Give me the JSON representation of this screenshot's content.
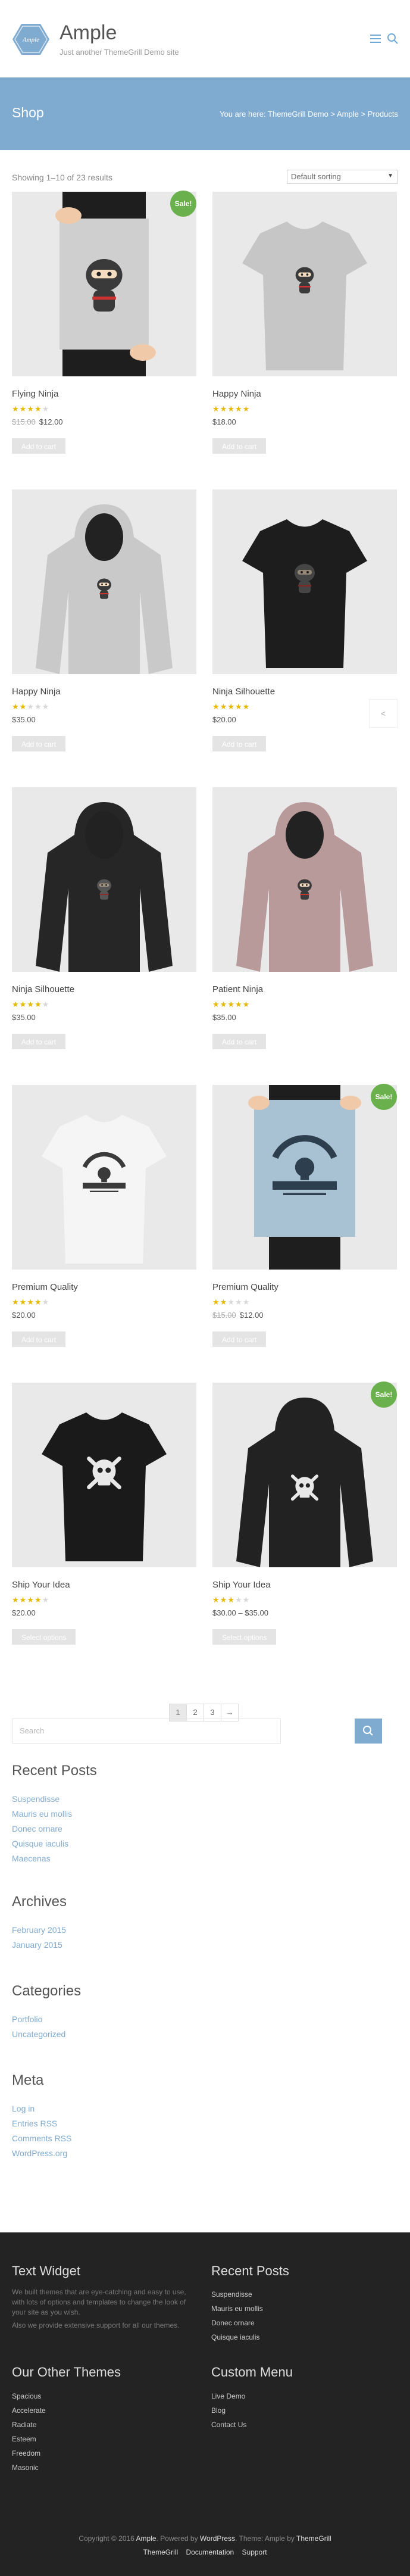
{
  "header": {
    "logo_text": "Ample",
    "site_title": "Ample",
    "tagline": "Just another ThemeGrill Demo site"
  },
  "banner": {
    "title": "Shop",
    "breadcrumb_prefix": "You are here:",
    "crumbs": [
      "ThemeGrill Demo",
      "Ample",
      "Products"
    ],
    "separator": ">"
  },
  "shop": {
    "result_count": "Showing 1–10 of 23 results",
    "sorting": "Default sorting"
  },
  "products": [
    {
      "name": "Flying Ninja",
      "rating": 4,
      "old_price": "$15.00",
      "price": "$12.00",
      "button": "Add to cart",
      "sale": true,
      "kind": "poster-ninja"
    },
    {
      "name": "Happy Ninja",
      "rating": 5,
      "old_price": "",
      "price": "$18.00",
      "button": "Add to cart",
      "sale": false,
      "kind": "tee-grey"
    },
    {
      "name": "Happy Ninja",
      "rating": 2,
      "old_price": "",
      "price": "$35.00",
      "button": "Add to cart",
      "sale": false,
      "kind": "hoodie-grey"
    },
    {
      "name": "Ninja Silhouette",
      "rating": 5,
      "old_price": "",
      "price": "$20.00",
      "button": "Add to cart",
      "sale": false,
      "kind": "tee-black"
    },
    {
      "name": "Ninja Silhouette",
      "rating": 4,
      "old_price": "",
      "price": "$35.00",
      "button": "Add to cart",
      "sale": false,
      "kind": "hoodie-black"
    },
    {
      "name": "Patient Ninja",
      "rating": 5,
      "old_price": "",
      "price": "$35.00",
      "button": "Add to cart",
      "sale": false,
      "kind": "hoodie-mauve"
    },
    {
      "name": "Premium Quality",
      "rating": 4,
      "old_price": "",
      "price": "$20.00",
      "button": "Add to cart",
      "sale": false,
      "kind": "tee-white"
    },
    {
      "name": "Premium Quality",
      "rating": 2,
      "old_price": "$15.00",
      "price": "$12.00",
      "button": "Add to cart",
      "sale": true,
      "kind": "poster-woo"
    },
    {
      "name": "Ship Your Idea",
      "rating": 4,
      "old_price": "",
      "price": "$20.00",
      "button": "Select options",
      "sale": false,
      "kind": "tee-skull"
    },
    {
      "name": "Ship Your Idea",
      "rating": 3,
      "old_price": "",
      "price": "$30.00 – $35.00",
      "button": "Select options",
      "sale": true,
      "kind": "hoodie-skull"
    }
  ],
  "sale_label": "Sale!",
  "carousel_arrow": "<",
  "pagination": [
    "1",
    "2",
    "3",
    "→"
  ],
  "sidebar": {
    "search_placeholder": "Search",
    "recent_posts_title": "Recent Posts",
    "recent_posts": [
      "Suspendisse",
      "Mauris eu mollis",
      "Donec ornare",
      "Quisque iaculis",
      "Maecenas"
    ],
    "archives_title": "Archives",
    "archives": [
      "February 2015",
      "January 2015"
    ],
    "categories_title": "Categories",
    "categories": [
      "Portfolio",
      "Uncategorized"
    ],
    "meta_title": "Meta",
    "meta": [
      "Log in",
      "Entries RSS",
      "Comments RSS",
      "WordPress.org"
    ]
  },
  "footer": {
    "text_widget_title": "Text Widget",
    "text_widget_p1": "We built themes that are eye-catching and easy to use, with lots of options and templates to change the look of your site as you wish.",
    "text_widget_p2": "Also we provide extensive support for all our themes.",
    "recent_title": "Recent Posts",
    "recent": [
      "Suspendisse",
      "Mauris eu mollis",
      "Donec ornare",
      "Quisque iaculis"
    ],
    "themes_title": "Our Other Themes",
    "themes": [
      "Spacious",
      "Accelerate",
      "Radiate",
      "Esteem",
      "Freedom",
      "Masonic"
    ],
    "custom_title": "Custom Menu",
    "custom": [
      "Live Demo",
      "Blog",
      "Contact Us"
    ],
    "copyright_pre": "Copyright © 2016",
    "copyright_site": "Ample",
    "powered_pre": ". Powered by",
    "powered_wp": "WordPress",
    "theme_pre": ". Theme: Ample by",
    "theme_by": "ThemeGrill",
    "bottom_links": [
      "ThemeGrill",
      "Documentation",
      "Support"
    ]
  },
  "colors": {
    "accent": "#80abd1",
    "sale": "#6ab04c",
    "star": "#e6b800",
    "footer_bg": "#232323"
  }
}
